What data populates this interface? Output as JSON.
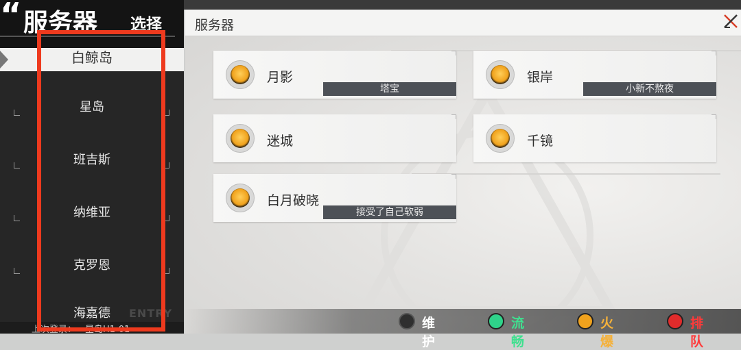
{
  "window": {
    "title": "服务器"
  },
  "sidebar": {
    "title_mark": "“",
    "title": "服务器",
    "subtitle": "选择",
    "selected": "白鲸岛",
    "items": [
      {
        "label": "星岛"
      },
      {
        "label": "班吉斯"
      },
      {
        "label": "纳维亚"
      },
      {
        "label": "克罗恩"
      },
      {
        "label": "海嘉德"
      }
    ],
    "footer_label": "上次登录：",
    "footer_value": "星岛H1-01",
    "deco_text": "ENTRY"
  },
  "servers": [
    {
      "name": "月影",
      "tag": "塔宝",
      "status": "busy"
    },
    {
      "name": "银岸",
      "tag": "小新不熬夜",
      "status": "busy"
    },
    {
      "name": "迷城",
      "tag": "",
      "status": "busy"
    },
    {
      "name": "千镜",
      "tag": "",
      "status": "busy"
    },
    {
      "name": "白月破晓",
      "tag": "接受了自己软弱",
      "status": "busy"
    }
  ],
  "legend": [
    {
      "label": "维护",
      "color": "#2f2f2f",
      "text_color": "#ffffff"
    },
    {
      "label": "流畅",
      "color": "#2fd38a",
      "text_color": "#3fe08f"
    },
    {
      "label": "火爆",
      "color": "#f0a21d",
      "text_color": "#f5b13a"
    },
    {
      "label": "排队",
      "color": "#e02b2b",
      "text_color": "#ff3a3a"
    }
  ],
  "colors": {
    "highlight": "#ee3a1e",
    "sidebar_bg": "#262626",
    "tag_bg": "#4d5157"
  }
}
